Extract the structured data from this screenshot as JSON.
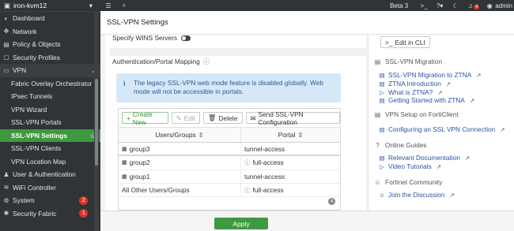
{
  "sidebar": {
    "device": "iron-kvm12",
    "items": [
      {
        "label": "Dashboard",
        "icon": "dashboard-icon",
        "glyph": "◐"
      },
      {
        "label": "Network",
        "icon": "network-icon",
        "glyph": "✥"
      },
      {
        "label": "Policy & Objects",
        "icon": "policy-icon",
        "glyph": "▤"
      },
      {
        "label": "Security Profiles",
        "icon": "security-profiles-icon",
        "glyph": "▢"
      },
      {
        "label": "VPN",
        "icon": "vpn-icon",
        "glyph": "▭"
      }
    ],
    "vpn_sub": [
      {
        "label": "Fabric Overlay Orchestrator"
      },
      {
        "label": "IPsec Tunnels"
      },
      {
        "label": "VPN Wizard"
      },
      {
        "label": "SSL-VPN Portals"
      },
      {
        "label": "SSL-VPN Settings"
      },
      {
        "label": "SSL-VPN Clients"
      },
      {
        "label": "VPN Location Map"
      }
    ],
    "bottom": [
      {
        "label": "User & Authentication",
        "icon": "user-icon",
        "glyph": "♟"
      },
      {
        "label": "WiFi Controller",
        "icon": "wifi-icon",
        "glyph": "≋"
      },
      {
        "label": "System",
        "icon": "system-icon",
        "glyph": "⚙",
        "badge": "2"
      },
      {
        "label": "Security Fabric",
        "icon": "security-fabric-icon",
        "glyph": "✱",
        "badge": "1"
      }
    ]
  },
  "topbar": {
    "version": "Beta 3",
    "notifications": "4",
    "user": "admin"
  },
  "page": {
    "title": "SSL-VPN Settings"
  },
  "form": {
    "wins_label": "Specify WINS Servers",
    "auth_heading": "Authentication/Portal Mapping",
    "notice": "The legacy SSL-VPN web mode feature is disabled globally. Web mode will not be accessible in portals."
  },
  "table": {
    "toolbar": {
      "create": "Create New",
      "edit": "Edit",
      "delete": "Delete",
      "send": "Send SSL-VPN Configuration"
    },
    "columns": [
      "Users/Groups",
      "Portal"
    ],
    "rows": [
      {
        "group": "group3",
        "portal": "tunnel-access"
      },
      {
        "group": "group2",
        "portal": "full-access"
      },
      {
        "group": "group1",
        "portal": "tunnel-access"
      },
      {
        "group": "All Other Users/Groups",
        "portal": "full-access"
      }
    ],
    "count": "4"
  },
  "footer": {
    "apply": "Apply"
  },
  "right": {
    "cli": "Edit in CLI",
    "sections": [
      {
        "title": "SSL-VPN Migration",
        "links": [
          "SSL-VPN Migration to ZTNA",
          "ZTNA Introduction",
          "What is ZTNA?",
          "Getting Started with ZTNA"
        ]
      },
      {
        "title": "VPN Setup on FortiClient",
        "links": [
          "Configuring an SSL VPN Connection"
        ]
      },
      {
        "title": "Online Guides",
        "links": [
          "Relevant Documentation",
          "Video Tutorials"
        ]
      },
      {
        "title": "Fortinet Community",
        "links": [
          "Join the Discussion"
        ]
      }
    ]
  }
}
